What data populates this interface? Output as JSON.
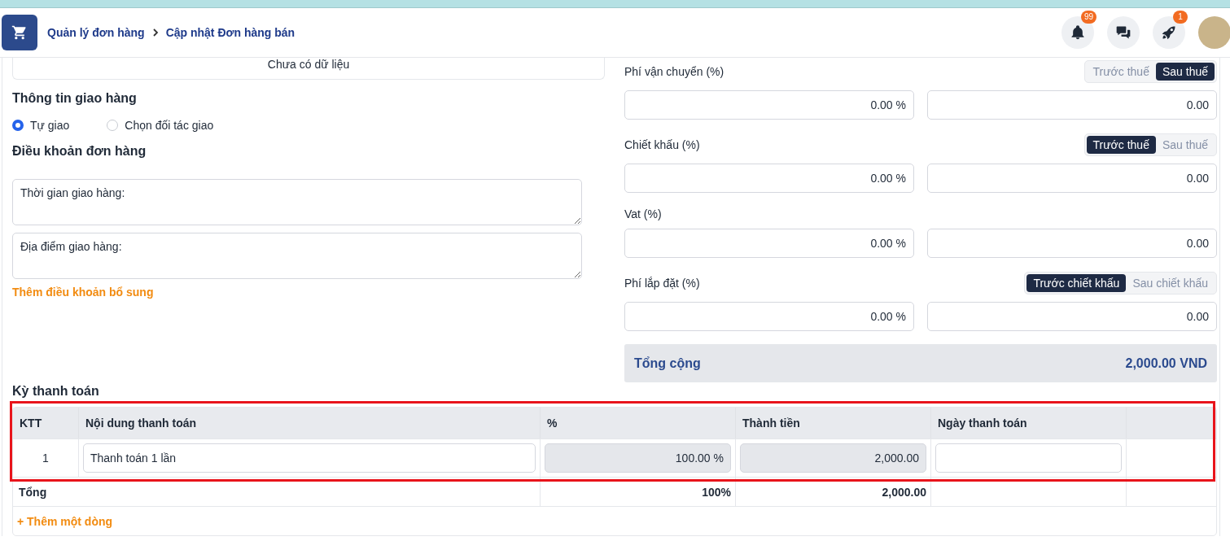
{
  "breadcrumb": [
    {
      "label": "Quản lý đơn hàng"
    },
    {
      "label": "Cập nhật Đơn hàng bán"
    }
  ],
  "header_icons": [
    {
      "kind": "bell",
      "badge": "99"
    },
    {
      "kind": "chat"
    },
    {
      "kind": "rocket",
      "badge": "1"
    },
    {
      "kind": "avatar"
    }
  ],
  "empty_message": "Chưa có dữ liệu",
  "delivery": {
    "title": "Thông tin giao hàng",
    "options": [
      {
        "label": "Tự giao",
        "selected": true
      },
      {
        "label": "Chọn đối tác giao",
        "selected": false
      }
    ]
  },
  "terms": {
    "title": "Điều khoản đơn hàng",
    "fields": [
      {
        "value": "Thời gian giao hàng:"
      },
      {
        "value": "Địa điểm giao hàng:"
      }
    ],
    "add_link": "Thêm điều khoản bổ sung"
  },
  "fees": [
    {
      "label": "Phí vận chuyển (%)",
      "toggle": [
        {
          "label": "Trước thuế",
          "selected": false
        },
        {
          "label": "Sau thuế",
          "selected": true
        }
      ],
      "percent": "0.00 %",
      "amount": "0.00"
    },
    {
      "label": "Chiết khấu (%)",
      "toggle": [
        {
          "label": "Trước thuế",
          "selected": true
        },
        {
          "label": "Sau thuế",
          "selected": false
        }
      ],
      "percent": "0.00 %",
      "amount": "0.00"
    },
    {
      "label": "Vat (%)",
      "percent": "0.00 %",
      "amount": "0.00"
    },
    {
      "label": "Phí lắp đặt (%)",
      "toggle": [
        {
          "label": "Trước chiết khấu",
          "selected": true
        },
        {
          "label": "Sau chiết khấu",
          "selected": false
        }
      ],
      "percent": "0.00 %",
      "amount": "0.00"
    }
  ],
  "total": {
    "label": "Tổng cộng",
    "value": "2,000.00 VND"
  },
  "payment": {
    "title": "Kỳ thanh toán",
    "columns": [
      "KTT",
      "Nội dung thanh toán",
      "%",
      "Thành tiền",
      "Ngày thanh toán"
    ],
    "rows": [
      {
        "cells": [
          {
            "kind": "text",
            "value": "1"
          },
          {
            "kind": "input",
            "value": "Thanh toán 1 lần"
          },
          {
            "kind": "readonly",
            "value": "100.00 %"
          },
          {
            "kind": "readonly",
            "value": "2,000.00"
          },
          {
            "kind": "input"
          }
        ]
      }
    ],
    "totals": {
      "label": "Tổng",
      "percent": "100%",
      "amount": "2,000.00"
    },
    "add_row": "+ Thêm một dòng"
  }
}
